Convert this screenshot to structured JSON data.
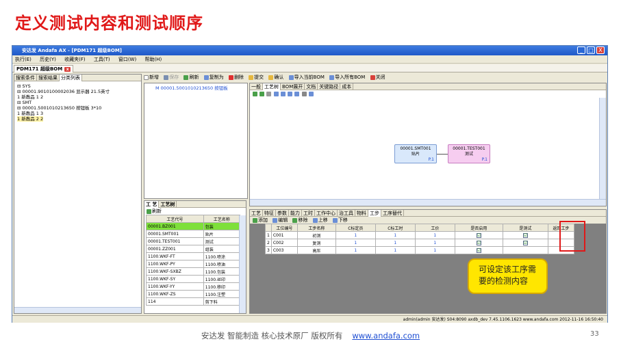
{
  "slide": {
    "title": "定义测试内容和测试顺序",
    "callout": [
      "可设定该工序需",
      "要的检测内容"
    ],
    "footer_text": "安达发  智能制造 核心技术原厂  版权所有",
    "footer_link": "www.andafa.com",
    "page_number": "33"
  },
  "window": {
    "title": "安达发 Andafa AX - [PDM171 超级BOM]",
    "controls": [
      "_",
      "□",
      "X"
    ]
  },
  "menu": [
    "执行(E)",
    "历史(Y)",
    "收藏夹(F)",
    "工具(T)",
    "窗口(W)",
    "帮助(H)"
  ],
  "doc_tab": "PDM171 超级BOM",
  "left_panel": {
    "tabs": [
      "搜索条件",
      "搜索结果",
      "分类列表"
    ],
    "tree": [
      "⊟ SYS",
      "  ⊟ 00001.9010100002036 显示器 21.5英寸",
      "     1  新教品  1 2",
      "⊟ SMT",
      "  ⊟ 00001.5001010213650 按钮板 3*10",
      "     1  新教品  1 3",
      "     1  新教品  2 2"
    ]
  },
  "toolbar": [
    "新增",
    "保存",
    "刷新",
    "复制为",
    "删除",
    "提交",
    "确认",
    "导入当前BOM",
    "导入所有BOM",
    "关闭"
  ],
  "mid_tree": "M 00001.5001010213650 按钮板",
  "right_tabs": [
    "一般",
    "工艺树",
    "BOM展开",
    "文档",
    "关键路径",
    "成本"
  ],
  "flow": {
    "node1": {
      "code": "00001.SMT001",
      "name": "贴片",
      "tag": "P.1"
    },
    "node2": {
      "code": "00001.TEST001",
      "name": "测试",
      "tag": "P.1"
    }
  },
  "process_panel": {
    "tabs": [
      "工 艺",
      "工艺树"
    ],
    "refresh": "刷新",
    "headers": [
      "工艺代号",
      "工艺名称"
    ],
    "rows": [
      [
        "00001.BZ001",
        "包装"
      ],
      [
        "00001.SMT001",
        "贴片"
      ],
      [
        "00001.TEST001",
        "测试"
      ],
      [
        "00001.ZZ001",
        "组装"
      ],
      [
        "1100.WKF-FT",
        "1100.喷涂"
      ],
      [
        "1100.WKF-PY",
        "1100.喷油"
      ],
      [
        "1100.WKF-SXBZ",
        "1100.包装"
      ],
      [
        "1100.WKF-SY",
        "1100.丝印"
      ],
      [
        "1100.WKF-YY",
        "1100.移印"
      ],
      [
        "1100.WKF-ZS",
        "1100.注塑"
      ],
      [
        "114",
        "剪下料"
      ]
    ]
  },
  "bottom_tabs": [
    "工艺",
    "特征",
    "参数",
    "能力",
    "工时",
    "工作中心",
    "治工具",
    "物料",
    "工步",
    "工序替代"
  ],
  "step_toolbar": [
    "添加",
    "编辑",
    "移除",
    "上移",
    "下移"
  ],
  "step_headers": [
    "",
    "工位编号",
    "工步名称",
    "C标定员",
    "C标工时",
    "工价",
    "是否启用",
    "是测试",
    "返回工步"
  ],
  "steps": [
    [
      "1",
      "C001",
      "初测",
      "1",
      "1",
      "1",
      "☑",
      "☑",
      ""
    ],
    [
      "2",
      "C002",
      "复测",
      "1",
      "1",
      "1",
      "☑",
      "☑",
      ""
    ],
    [
      "3",
      "C003",
      "高压",
      "1",
      "1",
      "1",
      "☑",
      "",
      ""
    ]
  ],
  "status": "admin(admin 安达发)  S04:8090  axdb_dev  7.45.1106.1623  www.andafa.com  2012-11-16 16:50:40"
}
